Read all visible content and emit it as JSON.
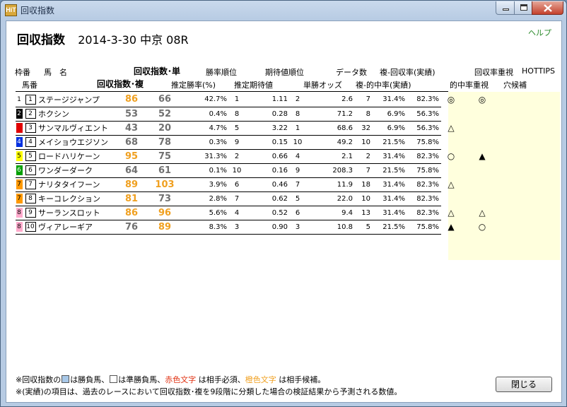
{
  "window": {
    "title": "回収指数",
    "icon_text": "HiT",
    "controls": {
      "minimize": "minimize-icon",
      "maximize": "maximize-icon",
      "close": "close-icon"
    }
  },
  "header": {
    "title_label": "回収指数",
    "date": "2014-3-30",
    "race": "中京 08R",
    "help": "ヘルプ"
  },
  "columns": {
    "row1": {
      "waku": "枠番",
      "uma": "馬　名",
      "index_tan": "回収指数･単",
      "win_rank": "勝率順位",
      "exp_rank": "期待値順位",
      "data_count": "データ数",
      "fuku_rate": "複-回収率(実績)",
      "kaishu_juushi": "回収率重視",
      "hottips": "HOTTIPS"
    },
    "row2": {
      "umaban": "馬番",
      "index_fuku": "回収指数･複",
      "est_win": "推定勝率(%)",
      "est_exp": "推定期待値",
      "odds": "単勝オッズ",
      "fuku_hit": "複-的中率(実績)",
      "teki_juushi": "的中率重視",
      "ana": "穴候補"
    }
  },
  "colors": {
    "orange": "#f0a020",
    "gray": "#707070",
    "red_text": "#e03010",
    "panel_yellow": "#ffffdd",
    "frame_colors": [
      "#ffffff",
      "#000000",
      "#e00000",
      "#0030e0",
      "#ffff00",
      "#00a000",
      "#ff9900",
      "#ff9900",
      "#ffaacc",
      "#ffaacc"
    ]
  },
  "rows": [
    {
      "waku": "1",
      "frame_bg": "#ffffff",
      "frame_fg": "#000000",
      "num": "1",
      "name": "ステージジャンプ",
      "tan": "86",
      "tan_color": "orange",
      "fuku": "66",
      "fuku_color": "gray",
      "win_pct": "42.7%",
      "win_rank": "1",
      "exp": "1.11",
      "exp_rank": "2",
      "odds": "2.6",
      "data": "7",
      "fuku_hit": "31.4%",
      "fuku_ret": "82.3%",
      "mark1": "◎",
      "mark2": "◎",
      "mark3": ""
    },
    {
      "waku": "2",
      "frame_bg": "#000000",
      "frame_fg": "#ffffff",
      "num": "2",
      "name": "ホクシン",
      "tan": "53",
      "tan_color": "gray",
      "fuku": "52",
      "fuku_color": "gray",
      "win_pct": "0.4%",
      "win_rank": "8",
      "exp": "0.28",
      "exp_rank": "8",
      "odds": "71.2",
      "data": "8",
      "fuku_hit": "6.9%",
      "fuku_ret": "56.3%",
      "mark1": "",
      "mark2": "",
      "mark3": ""
    },
    {
      "waku": "3",
      "frame_bg": "#e00000",
      "frame_fg": "#e00000",
      "num": "3",
      "name": "サンマルヴィエント",
      "tan": "43",
      "tan_color": "gray",
      "fuku": "20",
      "fuku_color": "gray",
      "win_pct": "4.7%",
      "win_rank": "5",
      "exp": "3.22",
      "exp_rank": "1",
      "odds": "68.6",
      "data": "32",
      "fuku_hit": "6.9%",
      "fuku_ret": "56.3%",
      "mark1": "△",
      "mark2": "",
      "mark3": ""
    },
    {
      "waku": "4",
      "frame_bg": "#0030e0",
      "frame_fg": "#ffffff",
      "num": "4",
      "name": "メイショウエジソン",
      "tan": "68",
      "tan_color": "gray",
      "fuku": "78",
      "fuku_color": "gray",
      "win_pct": "0.3%",
      "win_rank": "9",
      "exp": "0.15",
      "exp_rank": "10",
      "odds": "49.2",
      "data": "10",
      "fuku_hit": "21.5%",
      "fuku_ret": "75.8%",
      "mark1": "",
      "mark2": "",
      "mark3": ""
    },
    {
      "waku": "5",
      "frame_bg": "#ffff00",
      "frame_fg": "#000000",
      "num": "5",
      "name": "ロードハリケーン",
      "tan": "95",
      "tan_color": "orange",
      "fuku": "75",
      "fuku_color": "gray",
      "win_pct": "31.3%",
      "win_rank": "2",
      "exp": "0.66",
      "exp_rank": "4",
      "odds": "2.1",
      "data": "2",
      "fuku_hit": "31.4%",
      "fuku_ret": "82.3%",
      "mark1": "○",
      "mark2": "▲",
      "mark3": ""
    },
    {
      "waku": "6",
      "frame_bg": "#00a000",
      "frame_fg": "#ffffff",
      "num": "6",
      "name": "ワンダーダーク",
      "tan": "64",
      "tan_color": "gray",
      "fuku": "61",
      "fuku_color": "gray",
      "win_pct": "0.1%",
      "win_rank": "10",
      "exp": "0.16",
      "exp_rank": "9",
      "odds": "208.3",
      "data": "7",
      "fuku_hit": "21.5%",
      "fuku_ret": "75.8%",
      "mark1": "",
      "mark2": "",
      "mark3": ""
    },
    {
      "waku": "7",
      "frame_bg": "#ff9900",
      "frame_fg": "#000000",
      "num": "7",
      "name": "ナリタタイフーン",
      "tan": "89",
      "tan_color": "orange",
      "fuku": "103",
      "fuku_color": "orange",
      "win_pct": "3.9%",
      "win_rank": "6",
      "exp": "0.46",
      "exp_rank": "7",
      "odds": "11.9",
      "data": "18",
      "fuku_hit": "31.4%",
      "fuku_ret": "82.3%",
      "mark1": "△",
      "mark2": "",
      "mark3": ""
    },
    {
      "waku": "7",
      "frame_bg": "#ff9900",
      "frame_fg": "#000000",
      "num": "8",
      "name": "キーコレクション",
      "tan": "81",
      "tan_color": "orange",
      "fuku": "73",
      "fuku_color": "gray",
      "win_pct": "2.8%",
      "win_rank": "7",
      "exp": "0.62",
      "exp_rank": "5",
      "odds": "22.0",
      "data": "10",
      "fuku_hit": "31.4%",
      "fuku_ret": "82.3%",
      "mark1": "",
      "mark2": "",
      "mark3": ""
    },
    {
      "waku": "8",
      "frame_bg": "#ffaacc",
      "frame_fg": "#000000",
      "num": "9",
      "name": "サーランスロット",
      "tan": "86",
      "tan_color": "orange",
      "fuku": "96",
      "fuku_color": "orange",
      "win_pct": "5.6%",
      "win_rank": "4",
      "exp": "0.52",
      "exp_rank": "6",
      "odds": "9.4",
      "data": "13",
      "fuku_hit": "31.4%",
      "fuku_ret": "82.3%",
      "mark1": "△",
      "mark2": "△",
      "mark3": ""
    },
    {
      "waku": "8",
      "frame_bg": "#ffaacc",
      "frame_fg": "#000000",
      "num": "10",
      "name": "ヴィアレーギア",
      "tan": "76",
      "tan_color": "gray",
      "fuku": "89",
      "fuku_color": "orange",
      "win_pct": "8.3%",
      "win_rank": "3",
      "exp": "0.90",
      "exp_rank": "3",
      "odds": "10.8",
      "data": "5",
      "fuku_hit": "21.5%",
      "fuku_ret": "75.8%",
      "mark1": "▲",
      "mark2": "○",
      "mark3": ""
    }
  ],
  "notes": {
    "line1_a": "※回収指数の",
    "line1_b": "は勝負馬、",
    "line1_c": "は準勝負馬、",
    "line1_red": "赤色文字",
    "line1_d": " は相手必須、",
    "line1_orange": "橙色文字",
    "line1_e": " は相手候補。",
    "line2": "※(実績)の項目は、過去のレースにおいて回収指数･複を9段階に分類した場合の検証結果から予測される数値。"
  },
  "buttons": {
    "close_label": "閉じる"
  }
}
